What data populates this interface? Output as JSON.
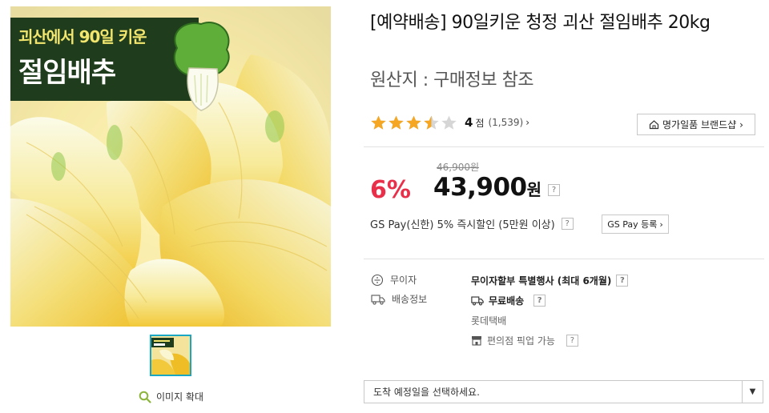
{
  "product": {
    "title": "[예약배송] 90일키운 청정 괴산 절임배추 20kg",
    "origin": "원산지 : 구매정보 참조",
    "image_banner": {
      "line1": "괴산에서 90일 키운",
      "line2": "절임배추"
    },
    "zoom_label": "이미지 확대"
  },
  "rating": {
    "stars": 3.5,
    "max_stars": 5,
    "score": "4",
    "score_unit": "점",
    "review_count": "(1,539)"
  },
  "brand_button": {
    "label": "명가일품 브랜드샵"
  },
  "price": {
    "discount": "6%",
    "original": "46,900원",
    "sale": "43,900",
    "sale_unit": "원",
    "help": "?"
  },
  "gspay": {
    "text": "GS Pay(신한) 5% 즉시할인 (5만원 이상)",
    "button_label": "GS Pay 등록"
  },
  "info": {
    "installment_label": "무이자",
    "installment_value": "무이자할부 특별행사 (최대 6개월)",
    "delivery_label": "배송정보",
    "delivery_value": "무료배송",
    "courier": "롯데택배",
    "pickup": "편의점 픽업 가능"
  },
  "select": {
    "placeholder": "도착 예정일을 선택하세요."
  },
  "colors": {
    "discount_red": "#e8304b",
    "star_gold": "#f5a623",
    "star_empty": "#d6d6d6",
    "thumb_border": "#19a7c4",
    "banner_green": "#1f3d1c",
    "banner_text_yellow": "#f3e66e"
  },
  "icons": [
    "star-icon",
    "chevron-right-icon",
    "home-icon",
    "question-icon",
    "won-circle-icon",
    "truck-icon",
    "store-icon",
    "magnifier-icon",
    "caret-down-icon"
  ]
}
